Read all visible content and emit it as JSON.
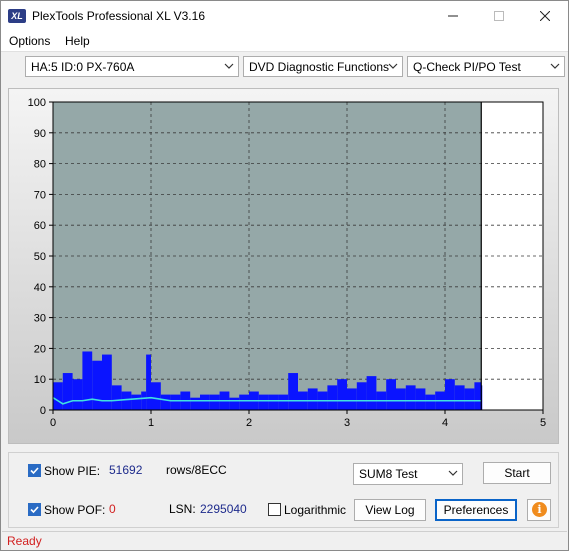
{
  "window": {
    "title": "PlexTools Professional XL V3.16",
    "logo_text": "XL",
    "controls": [
      "minimize-icon",
      "maximize-icon",
      "close-icon"
    ]
  },
  "menu": {
    "options_label": "Options",
    "help_label": "Help"
  },
  "toolbar": {
    "drive": "HA:5 ID:0  PX-760A",
    "function": "DVD Diagnostic Functions",
    "test": "Q-Check PI/PO Test"
  },
  "chart_data": {
    "type": "bar",
    "title": "",
    "xlabel": "",
    "ylabel": "",
    "xlim": [
      0,
      5
    ],
    "ylim": [
      0,
      100
    ],
    "x_ticks": [
      "0",
      "1",
      "2",
      "3",
      "4",
      "5"
    ],
    "y_ticks": [
      "0",
      "10",
      "20",
      "30",
      "40",
      "50",
      "60",
      "70",
      "80",
      "90",
      "100"
    ],
    "grid": true,
    "data_end_x": 4.37,
    "colors": {
      "pie_bars": "#0a14ff",
      "pif_line": "#40e0e0",
      "plot_bg": "#95a8a8",
      "unused_bg": "#ffffff"
    },
    "series": [
      {
        "name": "PIE",
        "x": [
          0.0,
          0.1,
          0.2,
          0.3,
          0.4,
          0.5,
          0.6,
          0.7,
          0.8,
          0.9,
          0.95,
          1.0,
          1.1,
          1.2,
          1.3,
          1.4,
          1.5,
          1.6,
          1.7,
          1.8,
          1.9,
          2.0,
          2.1,
          2.2,
          2.3,
          2.4,
          2.5,
          2.6,
          2.7,
          2.8,
          2.9,
          3.0,
          3.1,
          3.2,
          3.3,
          3.4,
          3.5,
          3.6,
          3.7,
          3.8,
          3.9,
          4.0,
          4.1,
          4.2,
          4.3,
          4.37
        ],
        "values": [
          9,
          12,
          10,
          19,
          16,
          18,
          8,
          6,
          5,
          6,
          18,
          9,
          5,
          5,
          6,
          4,
          5,
          5,
          6,
          4,
          5,
          6,
          5,
          5,
          5,
          12,
          6,
          7,
          6,
          8,
          10,
          7,
          9,
          11,
          6,
          10,
          7,
          8,
          7,
          5,
          6,
          10,
          8,
          7,
          9,
          8
        ]
      },
      {
        "name": "PIF",
        "x": [
          0.0,
          0.05,
          0.1,
          0.2,
          0.3,
          0.4,
          0.5,
          0.6,
          0.8,
          1.0,
          1.2,
          1.4,
          1.6,
          1.8,
          2.0,
          2.2,
          2.4,
          2.6,
          2.8,
          3.0,
          3.2,
          3.4,
          3.6,
          3.8,
          4.0,
          4.2,
          4.37
        ],
        "values": [
          4,
          3,
          2,
          3,
          3,
          3.5,
          3,
          3,
          3.5,
          4,
          3,
          3,
          3,
          3,
          3,
          3,
          3,
          3,
          3,
          3,
          3,
          3,
          3,
          3,
          3,
          3,
          3
        ]
      }
    ]
  },
  "panel": {
    "show_pie_label": "Show PIE:",
    "pie_value": "51692",
    "pie_unit": "rows/8ECC",
    "show_pof_label": "Show POF:",
    "pof_value": "0",
    "lsn_label": "LSN:",
    "lsn_value": "2295040",
    "logarithmic_label": "Logarithmic",
    "test_select": "SUM8 Test",
    "start_label": "Start",
    "view_log_label": "View Log",
    "preferences_label": "Preferences",
    "show_pie_checked": true,
    "show_pof_checked": true,
    "logarithmic_checked": false
  },
  "status": {
    "text": "Ready",
    "color": "#d22020"
  }
}
